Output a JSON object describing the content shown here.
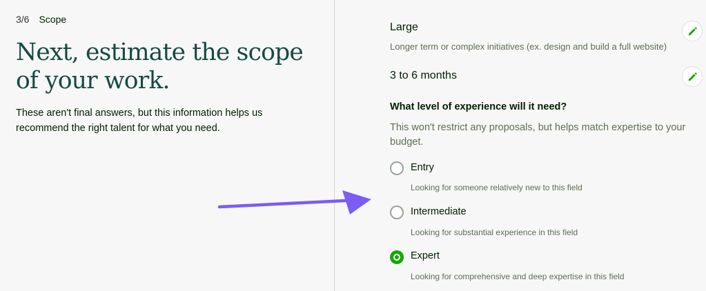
{
  "header": {
    "step_count": "3/6",
    "step_name": "Scope"
  },
  "intro": {
    "heading": "Next, estimate the scope of your work.",
    "subtext": "These aren't final answers, but this information helps us recommend the right talent for what you need."
  },
  "size": {
    "title": "Large",
    "description": "Longer term or complex initiatives (ex. design and build a full website)",
    "edit_icon": "pencil-icon"
  },
  "duration": {
    "title": "3 to 6 months",
    "edit_icon": "pencil-icon"
  },
  "experience": {
    "question": "What level of experience will it need?",
    "help": "This won't restrict any proposals, but helps match expertise to your budget.",
    "options": [
      {
        "label": "Entry",
        "description": "Looking for someone relatively new to this field",
        "selected": false
      },
      {
        "label": "Intermediate",
        "description": "Looking for substantial experience in this field",
        "selected": false
      },
      {
        "label": "Expert",
        "description": "Looking for comprehensive and deep expertise in this field",
        "selected": true
      }
    ]
  },
  "colors": {
    "heading": "#164a41",
    "accent": "#14a800",
    "annotation_arrow": "#7b5cf5",
    "background": "#f7f7f7"
  },
  "annotation": {
    "icon": "arrow-right-icon"
  }
}
